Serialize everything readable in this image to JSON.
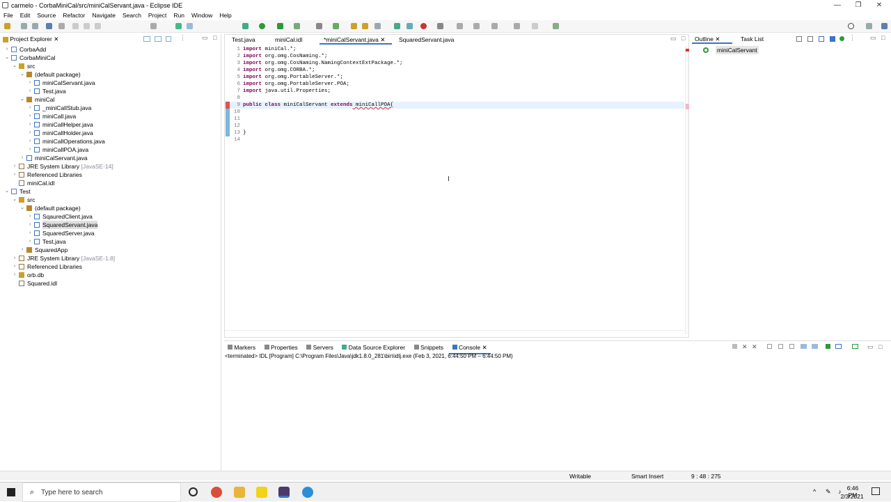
{
  "window": {
    "title": "carmelo - CorbaMiniCal/src/miniCalServant.java - Eclipse IDE",
    "controls": [
      "—",
      "❐",
      "✕"
    ]
  },
  "menu": [
    "File",
    "Edit",
    "Source",
    "Refactor",
    "Navigate",
    "Search",
    "Project",
    "Run",
    "Window",
    "Help"
  ],
  "project_explorer": {
    "tab": "Project Explorer",
    "items": [
      {
        "label": "CorbaAdd",
        "depth": 0,
        "arrow": "›",
        "icon": "project",
        "suffix": ""
      },
      {
        "label": "CorbaMiniCal",
        "depth": 0,
        "arrow": "⌄",
        "icon": "project",
        "suffix": ""
      },
      {
        "label": "src",
        "depth": 1,
        "arrow": "⌄",
        "icon": "folder",
        "suffix": ""
      },
      {
        "label": "(default package)",
        "depth": 2,
        "arrow": "⌄",
        "icon": "package",
        "suffix": ""
      },
      {
        "label": "miniCalServant.java",
        "depth": 3,
        "arrow": "›",
        "icon": "java",
        "suffix": ""
      },
      {
        "label": "Test.java",
        "depth": 3,
        "arrow": "›",
        "icon": "java",
        "suffix": ""
      },
      {
        "label": "miniCal",
        "depth": 2,
        "arrow": "⌄",
        "icon": "package",
        "suffix": ""
      },
      {
        "label": "_miniCallStub.java",
        "depth": 3,
        "arrow": "›",
        "icon": "java",
        "suffix": ""
      },
      {
        "label": "miniCall.java",
        "depth": 3,
        "arrow": "›",
        "icon": "java",
        "suffix": ""
      },
      {
        "label": "miniCallHelper.java",
        "depth": 3,
        "arrow": "›",
        "icon": "java",
        "suffix": ""
      },
      {
        "label": "miniCallHolder.java",
        "depth": 3,
        "arrow": "›",
        "icon": "java",
        "suffix": ""
      },
      {
        "label": "miniCallOperations.java",
        "depth": 3,
        "arrow": "›",
        "icon": "java",
        "suffix": ""
      },
      {
        "label": "miniCallPOA.java",
        "depth": 3,
        "arrow": "›",
        "icon": "java",
        "suffix": ""
      },
      {
        "label": "miniCalServant.java",
        "depth": 2,
        "arrow": "›",
        "icon": "java",
        "suffix": ""
      },
      {
        "label": "JRE System Library",
        "depth": 1,
        "arrow": "›",
        "icon": "lib",
        "suffix": " [JavaSE-14]"
      },
      {
        "label": "Referenced Libraries",
        "depth": 1,
        "arrow": "›",
        "icon": "lib",
        "suffix": ""
      },
      {
        "label": "miniCal.idl",
        "depth": 1,
        "arrow": "",
        "icon": "file",
        "suffix": ""
      },
      {
        "label": "Test",
        "depth": 0,
        "arrow": "⌄",
        "icon": "project",
        "suffix": ""
      },
      {
        "label": "src",
        "depth": 1,
        "arrow": "⌄",
        "icon": "folder",
        "suffix": ""
      },
      {
        "label": "(default package)",
        "depth": 2,
        "arrow": "⌄",
        "icon": "package",
        "suffix": ""
      },
      {
        "label": "SqauredClient.java",
        "depth": 3,
        "arrow": "›",
        "icon": "java",
        "suffix": ""
      },
      {
        "label": "SquaredServant.java",
        "depth": 3,
        "arrow": "›",
        "icon": "java",
        "suffix": "",
        "selected": true
      },
      {
        "label": "SquaredServer.java",
        "depth": 3,
        "arrow": "›",
        "icon": "java",
        "suffix": ""
      },
      {
        "label": "Test.java",
        "depth": 3,
        "arrow": "›",
        "icon": "java",
        "suffix": ""
      },
      {
        "label": "SquaredApp",
        "depth": 2,
        "arrow": "›",
        "icon": "package",
        "suffix": ""
      },
      {
        "label": "JRE System Library",
        "depth": 1,
        "arrow": "›",
        "icon": "lib",
        "suffix": " [JavaSE-1.8]"
      },
      {
        "label": "Referenced Libraries",
        "depth": 1,
        "arrow": "›",
        "icon": "lib",
        "suffix": ""
      },
      {
        "label": "orb.db",
        "depth": 1,
        "arrow": "›",
        "icon": "folder",
        "suffix": ""
      },
      {
        "label": "Squared.idl",
        "depth": 1,
        "arrow": "",
        "icon": "file",
        "suffix": ""
      }
    ]
  },
  "editor": {
    "tabs": [
      {
        "label": "Test.java",
        "active": false
      },
      {
        "label": "miniCal.idl",
        "active": false
      },
      {
        "label": "*miniCalServant.java",
        "active": true
      },
      {
        "label": "SquaredServant.java",
        "active": false
      }
    ],
    "lines": [
      {
        "n": "1",
        "kw": "import",
        "rest": " miniCal.*;"
      },
      {
        "n": "2",
        "kw": "import",
        "rest": " org.omg.CosNaming.*;"
      },
      {
        "n": "3",
        "kw": "import",
        "rest": " org.omg.CosNaming.NamingContextExtPackage.*;"
      },
      {
        "n": "4",
        "kw": "import",
        "rest": " org.omg.CORBA.*;"
      },
      {
        "n": "5",
        "kw": "import",
        "rest": " org.omg.PortableServer.*;"
      },
      {
        "n": "6",
        "kw": "import",
        "rest": " org.omg.PortableServer.POA;"
      },
      {
        "n": "7",
        "kw": "import",
        "rest": " java.util.Properties;"
      },
      {
        "n": "8",
        "kw": "",
        "rest": ""
      },
      {
        "n": "9",
        "kw": "public class",
        "rest": " miniCalServant ",
        "kw2": "extends",
        "rest2": " miniCallPOA{"
      },
      {
        "n": "10",
        "kw": "",
        "rest": ""
      },
      {
        "n": "11",
        "kw": "",
        "rest": ""
      },
      {
        "n": "12",
        "kw": "",
        "rest": ""
      },
      {
        "n": "13",
        "kw": "",
        "rest": "}"
      },
      {
        "n": "14",
        "kw": "",
        "rest": ""
      }
    ]
  },
  "outline": {
    "tabs": [
      "Outline",
      "Task List"
    ],
    "item": "miniCalServant"
  },
  "bottom": {
    "tabs": [
      "Markers",
      "Properties",
      "Servers",
      "Data Source Explorer",
      "Snippets",
      "Console"
    ],
    "console_header": "<terminated> IDL [Program] C:\\Program Files\\Java\\jdk1.8.0_281\\bin\\idlj.exe (Feb 3, 2021, 6:44:50 PM – 6:44:50 PM)"
  },
  "status": {
    "writable": "Writable",
    "insert": "Smart Insert",
    "position": "9 : 48 : 275"
  },
  "taskbar": {
    "search_placeholder": "Type here to search",
    "time": "6:46 PM",
    "date": "2/3/2021"
  }
}
